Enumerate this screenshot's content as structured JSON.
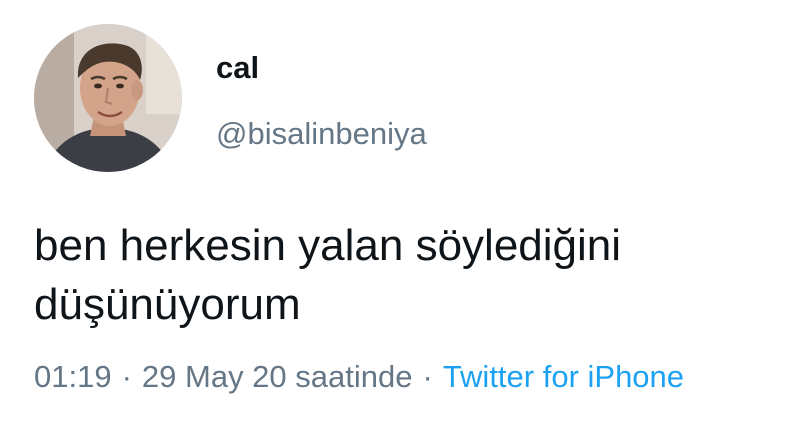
{
  "tweet": {
    "user": {
      "display_name": "cal",
      "handle": "@bisalinbeniya",
      "avatar_icon": "profile-photo"
    },
    "text_lines": [
      "ben herkesin yalan söylediğini",
      "düşünüyorum"
    ],
    "meta": {
      "time": "01:19",
      "separator": "·",
      "date": "29 May 20 saatinde",
      "source": "Twitter for iPhone"
    },
    "colors": {
      "primary_text": "#0f1419",
      "secondary_text": "#657786",
      "link": "#1da1f2",
      "background": "#ffffff"
    }
  }
}
